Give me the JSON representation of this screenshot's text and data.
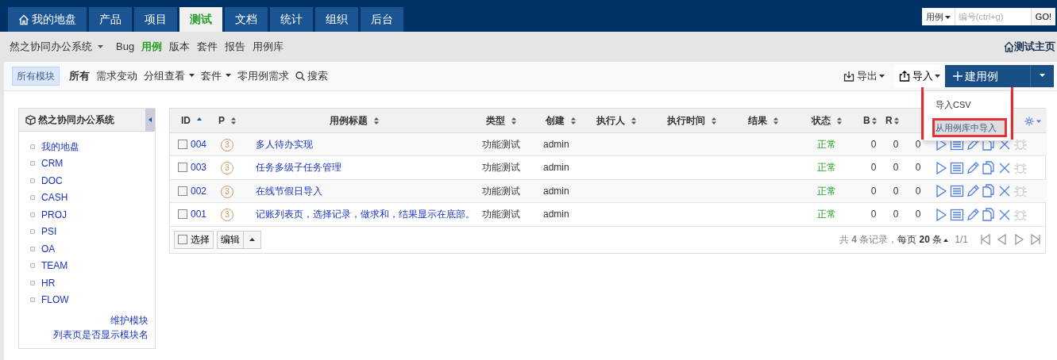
{
  "main_nav": {
    "tabs": [
      {
        "label": "我的地盘",
        "selected": false
      },
      {
        "label": "产品",
        "selected": false
      },
      {
        "label": "项目",
        "selected": false
      },
      {
        "label": "测试",
        "selected": true
      },
      {
        "label": "文档",
        "selected": false
      },
      {
        "label": "统计",
        "selected": false
      },
      {
        "label": "组织",
        "selected": false
      },
      {
        "label": "后台",
        "selected": false
      }
    ],
    "search": {
      "type": "用例",
      "placeholder": "编号(ctrl+g)",
      "button": "GO!"
    }
  },
  "sub_nav": {
    "product": "然之协同办公系统",
    "items": [
      {
        "label": "Bug",
        "selected": false
      },
      {
        "label": "用例",
        "selected": true
      },
      {
        "label": "版本",
        "selected": false
      },
      {
        "label": "套件",
        "selected": false
      },
      {
        "label": "报告",
        "selected": false
      },
      {
        "label": "用例库",
        "selected": false
      }
    ],
    "home_link": "测试主页"
  },
  "feature_bar": {
    "module": "所有模块",
    "items": [
      {
        "label": "所有",
        "selected": true,
        "dropdown": false
      },
      {
        "label": "需求变动",
        "selected": false,
        "dropdown": false
      },
      {
        "label": "分组查看",
        "selected": false,
        "dropdown": true
      },
      {
        "label": "套件",
        "selected": false,
        "dropdown": true
      },
      {
        "label": "零用例需求",
        "selected": false,
        "dropdown": false
      }
    ],
    "search": "搜索",
    "export": "导出",
    "import": "导入",
    "create": "建用例"
  },
  "import_menu": {
    "items": [
      {
        "label": "导入CSV",
        "selected": false
      },
      {
        "label": "从用例库中导入",
        "selected": true
      }
    ]
  },
  "sidebar": {
    "title": "然之协同办公系统",
    "items": [
      {
        "label": "我的地盘"
      },
      {
        "label": "CRM"
      },
      {
        "label": "DOC"
      },
      {
        "label": "CASH"
      },
      {
        "label": "PROJ"
      },
      {
        "label": "PSI"
      },
      {
        "label": "OA"
      },
      {
        "label": "TEAM"
      },
      {
        "label": "HR"
      },
      {
        "label": "FLOW"
      }
    ],
    "links": [
      "维护模块",
      "列表页是否显示模块名"
    ]
  },
  "table": {
    "columns": [
      {
        "label": "ID",
        "sorted": true
      },
      {
        "label": "P",
        "sorted": false
      },
      {
        "label": "用例标题",
        "sorted": false
      },
      {
        "label": "类型",
        "sorted": false
      },
      {
        "label": "创建",
        "sorted": false
      },
      {
        "label": "执行人",
        "sorted": false
      },
      {
        "label": "执行时间",
        "sorted": false
      },
      {
        "label": "结果",
        "sorted": false
      },
      {
        "label": "状态",
        "sorted": false
      },
      {
        "label": "B",
        "sorted": false
      },
      {
        "label": "R",
        "sorted": false
      }
    ],
    "rows": [
      {
        "id": "004",
        "checked": false,
        "priority": "3",
        "title": "多人待办实现",
        "type": "功能测试",
        "creator": "admin",
        "status": "正常",
        "b": "0",
        "r": "0",
        "column_12": "0"
      },
      {
        "id": "003",
        "checked": false,
        "priority": "3",
        "title": "任务多级子任务管理",
        "type": "功能测试",
        "creator": "admin",
        "status": "正常",
        "b": "0",
        "r": "0",
        "column_12": "0"
      },
      {
        "id": "002",
        "checked": false,
        "priority": "3",
        "title": "在线节假日导入",
        "type": "功能测试",
        "creator": "admin",
        "status": "正常",
        "b": "0",
        "r": "0",
        "column_12": "0"
      },
      {
        "id": "001",
        "checked": false,
        "priority": "3",
        "title": "记账列表页，选择记录，做求和，结果显示在底部。",
        "type": "功能测试",
        "creator": "admin",
        "status": "正常",
        "b": "0",
        "r": "0",
        "column_12": "0"
      }
    ],
    "footer": {
      "select": "选择",
      "edit": "编辑"
    },
    "pager": {
      "total": "共 **4** 条记录，",
      "per_page": "每页 **20** 条",
      "page": "1/1"
    }
  }
}
